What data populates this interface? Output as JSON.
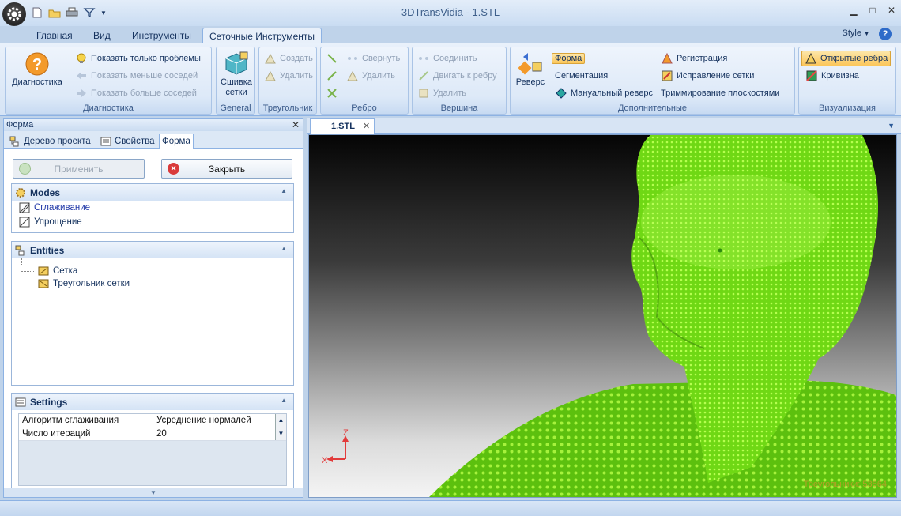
{
  "window": {
    "title": "3DTransVidia - 1.STL"
  },
  "ribbon_tabs": [
    "Главная",
    "Вид",
    "Инструменты",
    "Сеточные Инструменты"
  ],
  "style_menu": "Style",
  "ribbon": {
    "diagnostics": {
      "big": "Диагностика",
      "items": [
        "Показать только проблемы",
        "Показать меньше соседей",
        "Показать больше соседей"
      ],
      "label": "Диагностика"
    },
    "general": {
      "big_line1": "Сшивка",
      "big_line2": "сетки",
      "label": "General"
    },
    "triangle": {
      "items": [
        "Создать",
        "Удалить"
      ],
      "label": "Треугольник"
    },
    "edge": {
      "items": [
        "Свернуть",
        "Удалить"
      ],
      "label": "Ребро"
    },
    "vertex": {
      "items": [
        "Соединить",
        "Двигать к ребру",
        "Удалить"
      ],
      "label": "Вершина"
    },
    "extra": {
      "reverse": "Реверс",
      "items": [
        "Форма",
        "Сегментация",
        "Мануальный реверс",
        "Регистрация",
        "Исправление сетки",
        "Триммирование плоскостями"
      ],
      "label": "Дополнительные"
    },
    "visual": {
      "items": [
        "Открытые ребра",
        "Кривизна"
      ],
      "label": "Визуализация"
    }
  },
  "left_panel": {
    "title": "Форма",
    "tabs": [
      "Дерево проекта",
      "Свойства",
      "Форма"
    ],
    "apply": "Применить",
    "close": "Закрыть",
    "modes": {
      "title": "Modes",
      "items": [
        "Сглаживание",
        "Упрощение"
      ]
    },
    "entities": {
      "title": "Entities",
      "items": [
        "Сетка",
        "Треугольник сетки"
      ]
    },
    "settings": {
      "title": "Settings",
      "rows": [
        {
          "key": "Алгоритм сглаживания",
          "value": "Усреднение нормалей"
        },
        {
          "key": "Число итераций",
          "value": "20"
        }
      ]
    }
  },
  "document": {
    "tab": "1.STL"
  },
  "viewport": {
    "axis_z": "Z",
    "axis_x": "X",
    "watermark": "Треугольники: 53864"
  },
  "colors": {
    "mesh": "#7ee81c",
    "accent": "#fbc65a"
  }
}
